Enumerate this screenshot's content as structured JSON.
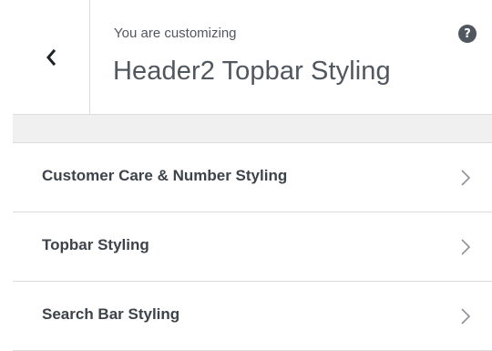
{
  "header": {
    "customizing_label": "You are customizing",
    "title": "Header2 Topbar Styling",
    "back_icon": "chevron-left-icon",
    "help_icon": "question-mark-icon",
    "help_glyph": "?"
  },
  "sections": [
    {
      "label": "Customer Care & Number Styling",
      "icon": "chevron-right-icon"
    },
    {
      "label": "Topbar Styling",
      "icon": "chevron-right-icon"
    },
    {
      "label": "Search Bar Styling",
      "icon": "chevron-right-icon"
    }
  ],
  "colors": {
    "text": "#50575e",
    "item_text": "#3c434a",
    "divider": "#dcdcde",
    "band": "#f0f0f1",
    "background": "#ffffff"
  }
}
